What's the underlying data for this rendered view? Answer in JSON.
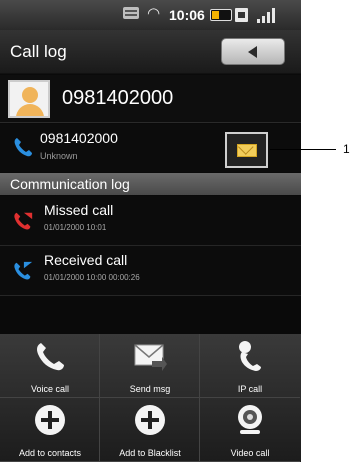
{
  "status_bar": {
    "time": "10:06",
    "icons": [
      "message-icon",
      "wifi-icon",
      "battery-icon",
      "sim-icon",
      "signal-icon"
    ]
  },
  "header": {
    "title": "Call log",
    "back_icon": "back-arrow-icon"
  },
  "contact": {
    "number": "0981402000"
  },
  "number_row": {
    "number": "0981402000",
    "location": "Unknown",
    "message_icon": "envelope-icon"
  },
  "callout": {
    "label": "1"
  },
  "section": {
    "title": "Communication log"
  },
  "log_items": [
    {
      "title": "Missed call",
      "meta": "01/01/2000  10:01",
      "type": "missed",
      "icon_color": "#e03030"
    },
    {
      "title": "Received call",
      "meta": "01/01/2000  10:00  00:00:26",
      "type": "received",
      "icon_color": "#2a8fe0"
    }
  ],
  "actions": [
    {
      "label": "Voice call",
      "icon": "phone-handset-icon"
    },
    {
      "label": "Send msg",
      "icon": "send-message-icon"
    },
    {
      "label": "IP call",
      "icon": "ip-call-icon"
    },
    {
      "label": "Add to contacts",
      "icon": "add-icon"
    },
    {
      "label": "Add to Blacklist",
      "icon": "add-icon"
    },
    {
      "label": "Video call",
      "icon": "webcam-icon"
    }
  ],
  "colors": {
    "background": "#0a0a0a",
    "section_header": "#5a5a5a",
    "phone_blue": "#2a8fe0",
    "missed_red": "#e03030",
    "envelope": "#f2cd5a"
  }
}
